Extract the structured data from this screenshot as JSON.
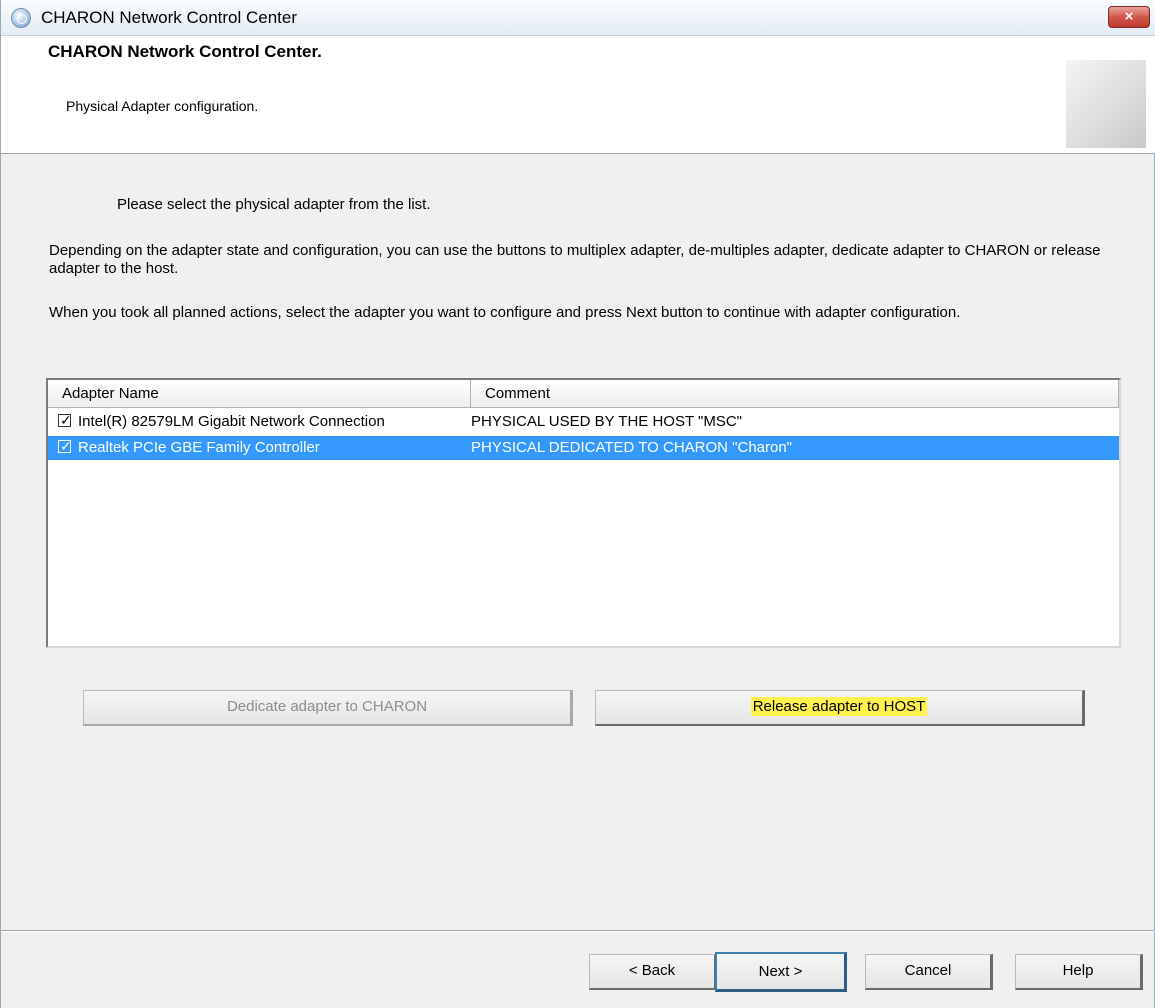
{
  "window": {
    "title": "CHARON Network Control Center",
    "close_label": "×"
  },
  "header": {
    "title": "CHARON Network Control Center.",
    "subtitle": "Physical Adapter configuration."
  },
  "body": {
    "instruction": "Please select the physical adapter from the list.",
    "paragraph1": "Depending on the adapter state and configuration, you can use the buttons to multiplex adapter, de-multiples adapter, dedicate adapter to CHARON or release adapter to the host.",
    "paragraph2": "When you took all planned actions, select the adapter you want to configure and press Next button to continue with adapter configuration."
  },
  "adapter_list": {
    "columns": [
      "Adapter Name",
      "Comment"
    ],
    "rows": [
      {
        "name": "Intel(R) 82579LM Gigabit Network Connection",
        "comment": "PHYSICAL USED BY THE HOST \"MSC\"",
        "checked": true,
        "selected": false
      },
      {
        "name": "Realtek PCIe GBE Family Controller",
        "comment": "PHYSICAL DEDICATED TO CHARON \"Charon\"",
        "checked": true,
        "selected": true
      }
    ]
  },
  "actions": {
    "dedicate_label": "Dedicate adapter to CHARON",
    "dedicate_enabled": false,
    "release_label": "Release adapter to HOST",
    "release_enabled": true
  },
  "footer": {
    "back_label": "< Back",
    "next_label": "Next >",
    "cancel_label": "Cancel",
    "help_label": "Help"
  },
  "colors": {
    "selection": "#3399ff",
    "highlight": "#fff24d",
    "close_button": "#c0392b"
  }
}
